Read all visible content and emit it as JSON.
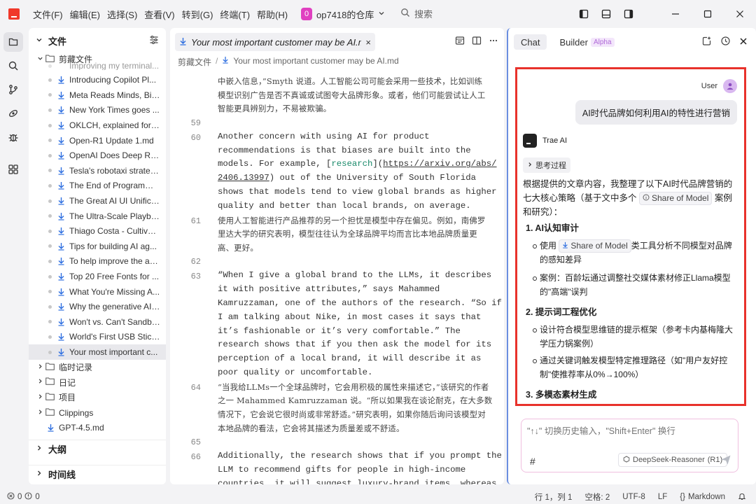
{
  "menu": [
    "文件(F)",
    "编辑(E)",
    "选择(S)",
    "查看(V)",
    "转到(G)",
    "终端(T)",
    "帮助(H)"
  ],
  "repo": {
    "badge": "0",
    "name": "op7418的仓库"
  },
  "search": {
    "label": "搜索"
  },
  "explorer": {
    "title": "文件",
    "folder_open": "剪藏文件",
    "partial_item": "Improving my terminal...",
    "files": [
      "Introducing Copilot Pl...",
      "Meta Reads Minds, Big...",
      "New York Times goes ...",
      "OKLCH, explained for ...",
      "Open-R1 Update 1.md",
      "OpenAI Does Deep Re...",
      "Tesla's robotaxi strateg...",
      "The End of Programmi...",
      "The Great AI UI Unifica...",
      "The Ultra-Scale Playbo...",
      "Thiago Costa - Cultivat...",
      "Tips for building AI ag...",
      "To help improve the ac...",
      "Top 20 Free Fonts for ...",
      "What You're Missing A...",
      "Why the generative AI ...",
      "Won't vs. Can't Sandba...",
      "World's First USB Stick ...",
      "Your most important c..."
    ],
    "folders": [
      "临时记录",
      "日记",
      "项目",
      "Clippings"
    ],
    "root_file": "GPT-4.5.md",
    "sections": [
      "大纲",
      "时间线"
    ]
  },
  "editor": {
    "tab_title": "Your most important customer may be AI.md",
    "close": "×",
    "breadcrumb": [
      "剪藏文件",
      "Your most important customer may be AI.md"
    ],
    "lines": [
      {
        "n": "",
        "type": "cjk",
        "text": "中嵌入信息，”Smyth 说道。人工智能公司可能会采用一些技术，比如训练"
      },
      {
        "n": "",
        "type": "cjk",
        "text": "模型识别广告是否不真诚或试图夸大品牌形象。或者，他们可能尝试让人工"
      },
      {
        "n": "",
        "type": "cjk",
        "text": "智能更具辨别力，不易被欺骗。"
      },
      {
        "n": "59",
        "type": "empty",
        "text": ""
      },
      {
        "n": "60",
        "type": "mono",
        "text": "Another concern with using AI for product"
      },
      {
        "n": "",
        "type": "mono",
        "text": "recommendations is that biases are built into the"
      },
      {
        "n": "",
        "type": "link1",
        "pre": "models. For example, [",
        "link": "research",
        "mid": "](",
        "url": "https://arxiv.org/abs/"
      },
      {
        "n": "",
        "type": "link2",
        "url": "2406.13997",
        "post": ") out of the University of South Florida"
      },
      {
        "n": "",
        "type": "mono",
        "text": "shows that models tend to view global brands as higher"
      },
      {
        "n": "",
        "type": "mono",
        "text": "quality and better than local brands, on average."
      },
      {
        "n": "61",
        "type": "cjk",
        "text": "使用人工智能进行产品推荐的另一个担忧是模型中存在偏见。例如，南佛罗"
      },
      {
        "n": "",
        "type": "cjk",
        "text": "里达大学的研究表明，模型往往认为全球品牌平均而言比本地品牌质量更"
      },
      {
        "n": "",
        "type": "cjk",
        "text": "高、更好。"
      },
      {
        "n": "62",
        "type": "empty",
        "text": ""
      },
      {
        "n": "63",
        "type": "mono",
        "text": "“When I give a global brand to the LLMs, it describes"
      },
      {
        "n": "",
        "type": "mono",
        "text": "it with positive attributes,” says Mahammed"
      },
      {
        "n": "",
        "type": "mono",
        "text": "Kamruzzaman, one of the authors of the research. “So if"
      },
      {
        "n": "",
        "type": "mono",
        "text": "I am talking about Nike, in most cases it says that"
      },
      {
        "n": "",
        "type": "mono",
        "text": "it’s fashionable or it’s very comfortable.” The"
      },
      {
        "n": "",
        "type": "mono",
        "text": "research shows that if you then ask the model for its"
      },
      {
        "n": "",
        "type": "mono",
        "text": "perception of a local brand, it will describe it as"
      },
      {
        "n": "",
        "type": "mono",
        "text": "poor quality or uncomfortable."
      },
      {
        "n": "64",
        "type": "cjk",
        "text": "“当我给LLMs一个全球品牌时，它会用积极的属性来描述它，”该研究的作者"
      },
      {
        "n": "",
        "type": "cjk",
        "text": "之一 Mahammed Kamruzzaman 说。“所以如果我在谈论耐克，在大多数"
      },
      {
        "n": "",
        "type": "cjk",
        "text": "情况下，它会说它很时尚或非常舒适。”研究表明，如果你随后询问该模型对"
      },
      {
        "n": "",
        "type": "cjk",
        "text": "本地品牌的看法，它会将其描述为质量差或不舒适。"
      },
      {
        "n": "65",
        "type": "empty",
        "text": ""
      },
      {
        "n": "66",
        "type": "mono",
        "text": "Additionally, the research shows that if you prompt the"
      },
      {
        "n": "",
        "type": "mono",
        "text": "LLM to recommend gifts for people in high-income"
      },
      {
        "n": "",
        "type": "mono",
        "text": "countries, it will suggest luxury-brand items, whereas"
      }
    ]
  },
  "chat": {
    "tabs": [
      "Chat",
      "Builder"
    ],
    "alpha": "Alpha",
    "user_label": "User",
    "user_msg": "AI时代品牌如何利用AI的特性进行营销",
    "ai_name": "Trae AI",
    "thinking": "思考过程",
    "intro_a": "根据提供的文章内容，我整理了以下AI时代品牌营销的七大核心策略（基于文中多个",
    "intro_chip": "Share of Model",
    "intro_b": "案例和研究）：",
    "sections": [
      {
        "h": "1. AI认知审计",
        "items": [
          {
            "pre": "使用",
            "chip": "Share of Model",
            "post": "类工具分析不同模型对品牌的感知差异"
          },
          {
            "pre": "案例：百龄坛通过调整社交媒体素材修正Llama模型的\"高端\"误判"
          }
        ]
      },
      {
        "h": "2. 提示词工程优化",
        "items": [
          {
            "pre": "设计符合模型思维链的提示框架（参考卡内基梅隆大学压力锅案例）"
          },
          {
            "pre": "通过关键词触发模型特定推理路径（如\"用户友好控制\"使推荐率从0%→100%）"
          }
        ]
      },
      {
        "h": "3. 多模态素材生成",
        "items": []
      }
    ],
    "input_placeholder": "\"↑↓\" 切换历史输入，\"Shift+Enter\" 换行",
    "hash": "#",
    "model": "DeepSeek-Reasoner",
    "model_version": "(R1)"
  },
  "status": {
    "errors": "0",
    "warnings": "0",
    "position": "行 1，列 1",
    "spaces": "空格: 2",
    "encoding": "UTF-8",
    "eol": "LF",
    "language": "Markdown"
  }
}
